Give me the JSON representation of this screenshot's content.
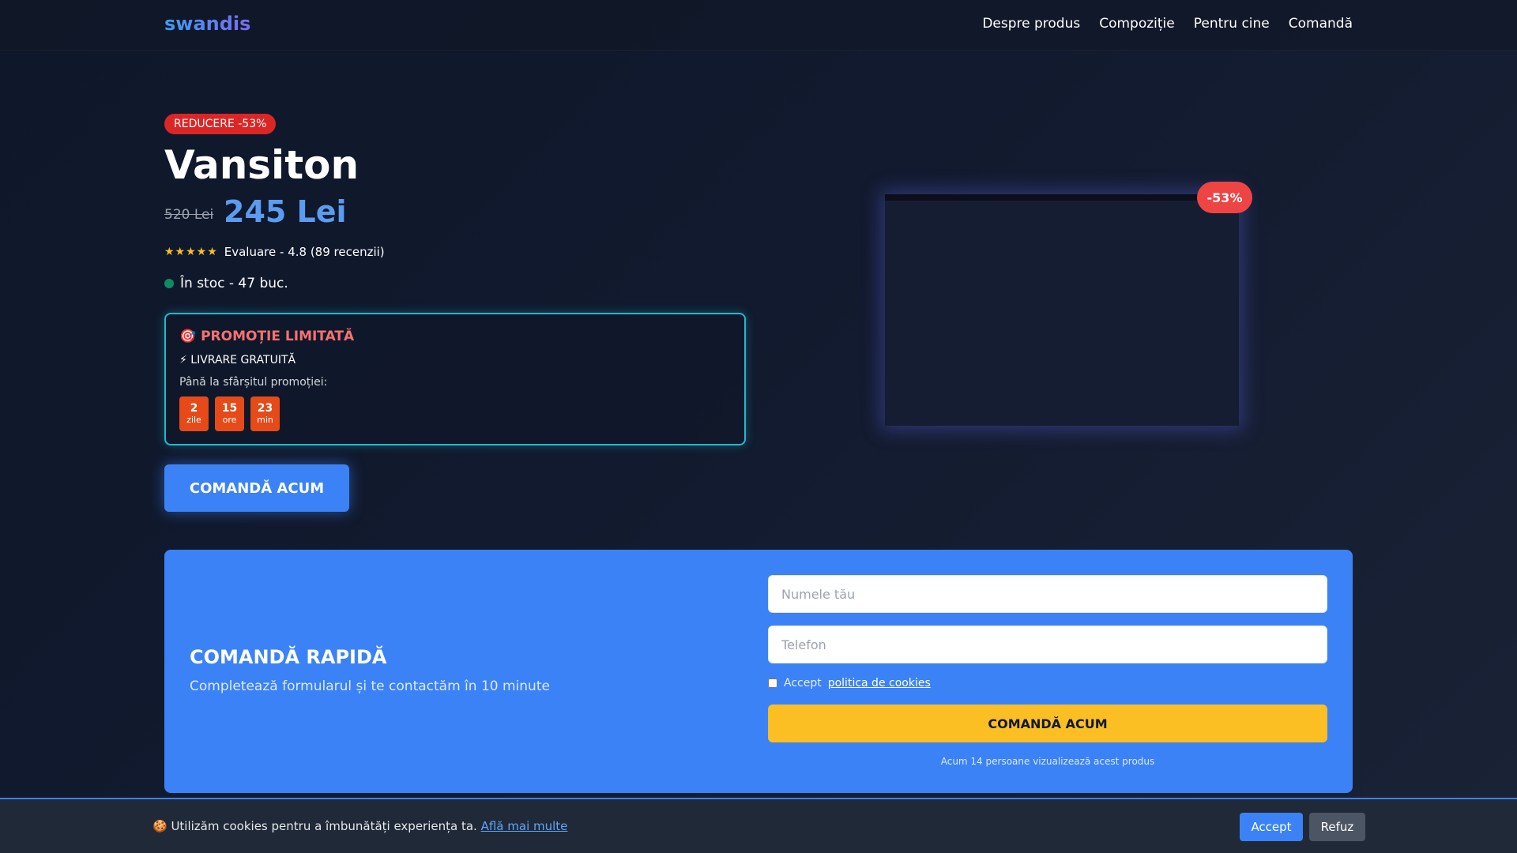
{
  "header": {
    "logo": "swandis",
    "nav": [
      "Despre produs",
      "Compoziție",
      "Pentru cine",
      "Comandă"
    ]
  },
  "hero": {
    "discount_badge": "REDUCERE -53%",
    "title": "Vansiton",
    "old_price": "520 Lei",
    "new_price": "245 Lei",
    "stars": "★★★★★",
    "rating_text": "Evaluare - 4.8 (89 recenzii)",
    "stock_text": "În stoc - 47 buc.",
    "cta_label": "COMANDĂ ACUM",
    "image_badge": "-53%"
  },
  "promo": {
    "title": "🎯 PROMOȚIE LIMITATĂ",
    "shipping": "⚡ LIVRARE GRATUITĂ",
    "until_label": "Până la sfârșitul promoției:",
    "countdown": [
      {
        "value": "2",
        "unit": "zile"
      },
      {
        "value": "15",
        "unit": "ore"
      },
      {
        "value": "23",
        "unit": "min"
      }
    ]
  },
  "quick_order": {
    "title": "COMANDĂ RAPIDĂ",
    "subtitle": "Completează formularul și te contactăm în 10 minute",
    "name_placeholder": "Numele tău",
    "phone_placeholder": "Telefon",
    "consent_prefix": "Accept",
    "consent_link": "politica de cookies",
    "submit_label": "COMANDĂ ACUM",
    "viewers_text": "Acum 14 persoane vizualizează acest produs"
  },
  "cookie_bar": {
    "text": "🍪 Utilizăm cookies pentru a îmbunătăți experiența ta.",
    "link": "Află mai multe",
    "accept_label": "Accept",
    "refuse_label": "Refuz"
  },
  "colors": {
    "accent": "#3b82f6",
    "price": "#5b9cf0",
    "danger": "#dc2626",
    "warning": "#fbbf24",
    "promo_border": "#22b8cf",
    "countdown_bg": "#e64a19"
  }
}
